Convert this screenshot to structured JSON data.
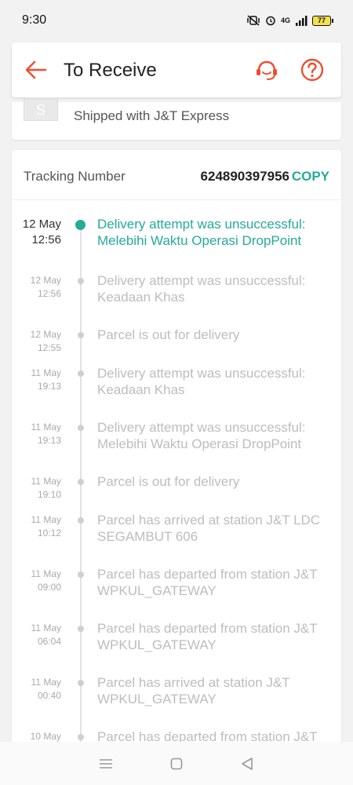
{
  "status_bar": {
    "time": "9:30",
    "network": "4G",
    "battery": "77"
  },
  "header": {
    "title": "To Receive"
  },
  "shipping": {
    "logo_letter": "S",
    "carrier_text": "Shipped with J&T Express"
  },
  "tracking": {
    "label": "Tracking Number",
    "number": "624890397956",
    "copy_label": "COPY",
    "events": [
      {
        "date": "12 May",
        "time": "12:56",
        "text": "Delivery attempt was unsuccessful: Melebihi Waktu Operasi DropPoint",
        "active": true
      },
      {
        "date": "12 May",
        "time": "12:56",
        "text": "Delivery attempt was unsuccessful: Keadaan Khas",
        "active": false
      },
      {
        "date": "12 May",
        "time": "12:55",
        "text": "Parcel is out for delivery",
        "active": false
      },
      {
        "date": "11 May",
        "time": "19:13",
        "text": "Delivery attempt was unsuccessful: Keadaan Khas",
        "active": false
      },
      {
        "date": "11 May",
        "time": "19:13",
        "text": "Delivery attempt was unsuccessful: Melebihi Waktu Operasi DropPoint",
        "active": false
      },
      {
        "date": "11 May",
        "time": "19:10",
        "text": "Parcel is out for delivery",
        "active": false
      },
      {
        "date": "11 May",
        "time": "10:12",
        "text": "Parcel has arrived at station J&T LDC SEGAMBUT 606",
        "active": false
      },
      {
        "date": "11 May",
        "time": "09:00",
        "text": "Parcel has departed from station J&T WPKUL_GATEWAY",
        "active": false
      },
      {
        "date": "11 May",
        "time": "06:04",
        "text": "Parcel has departed from station J&T WPKUL_GATEWAY",
        "active": false
      },
      {
        "date": "11 May",
        "time": "00:40",
        "text": "Parcel has arrived at station J&T WPKUL_GATEWAY",
        "active": false
      },
      {
        "date": "10 May",
        "time": "",
        "text": "Parcel has departed from station J&T",
        "active": false
      }
    ]
  },
  "colors": {
    "accent": "#ee4d2d",
    "teal": "#26aa99"
  }
}
